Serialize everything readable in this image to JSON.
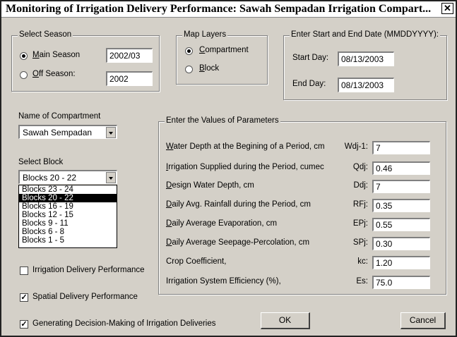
{
  "window": {
    "title": "Monitoring of Irrigation Delivery Performance: Sawah Sempadan Irrigation Compart...",
    "close_glyph": "✕"
  },
  "season": {
    "legend": "Select Season",
    "main_label_u": "M",
    "main_label_rest": "ain Season",
    "main_value": "2002/03",
    "main_selected": true,
    "off_label_u": "O",
    "off_label_rest": "ff Season:",
    "off_value": "2002",
    "off_selected": false
  },
  "map_layers": {
    "legend": "Map Layers",
    "compartment_u": "C",
    "compartment_rest": "ompartment",
    "compartment_selected": true,
    "block_u": "B",
    "block_rest": "lock",
    "block_selected": false
  },
  "dates": {
    "legend": "Enter Start and End Date (MMDDYYYY):",
    "start_label": "Start Day:",
    "start_value": "08/13/2003",
    "end_label": "End Day:",
    "end_value": "08/13/2003"
  },
  "compartment": {
    "label": "Name of Compartment",
    "value": "Sawah Sempadan"
  },
  "block": {
    "label": "Select Block",
    "value": "Blocks 20 - 22",
    "options": [
      "Blocks 23 - 24",
      "Blocks 20 - 22",
      "Blocks 16 - 19",
      "Blocks 12 - 15",
      "Blocks 9 - 11",
      "Blocks 6 - 8",
      "Blocks 1 - 5"
    ],
    "selected_index": 1
  },
  "parameters": {
    "legend": "Enter the Values of Parameters",
    "rows": [
      {
        "u": "W",
        "rest": "ater Depth at the Begining of a Period, cm",
        "symbol": "Wdj-1:",
        "value": "7"
      },
      {
        "u": "I",
        "rest": "rrigation Supplied during the Period, cumec",
        "symbol": "Qdj:",
        "value": "0.46"
      },
      {
        "u": "D",
        "rest": "esign Water Depth, cm",
        "symbol": "Ddj:",
        "value": "7"
      },
      {
        "u": "D",
        "rest": "aily Avg. Rainfall during the Period, cm",
        "symbol": "RFj:",
        "value": "0.35"
      },
      {
        "u": "D",
        "rest": "aily Average Evaporation, cm",
        "symbol": "EPj:",
        "value": "0.55"
      },
      {
        "u": "D",
        "rest": "aily Average Seepage-Percolation, cm",
        "symbol": "SPj:",
        "value": "0.30"
      },
      {
        "u": "",
        "rest": "Crop Coefficient,",
        "symbol": "kc:",
        "value": "1.20"
      },
      {
        "u": "",
        "rest": "Irrigation System Efficiency (%),",
        "symbol": "Es:",
        "value": "75.0"
      }
    ]
  },
  "options": {
    "irrigation_delivery": {
      "label": "Irrigation Delivery Performance",
      "checked": false
    },
    "spatial_delivery": {
      "label": "Spatial Delivery Performance",
      "checked": true
    },
    "decision_making": {
      "label": "Generating Decision-Making of Irrigation Deliveries",
      "checked": true
    }
  },
  "buttons": {
    "ok": "OK",
    "cancel": "Cancel"
  }
}
